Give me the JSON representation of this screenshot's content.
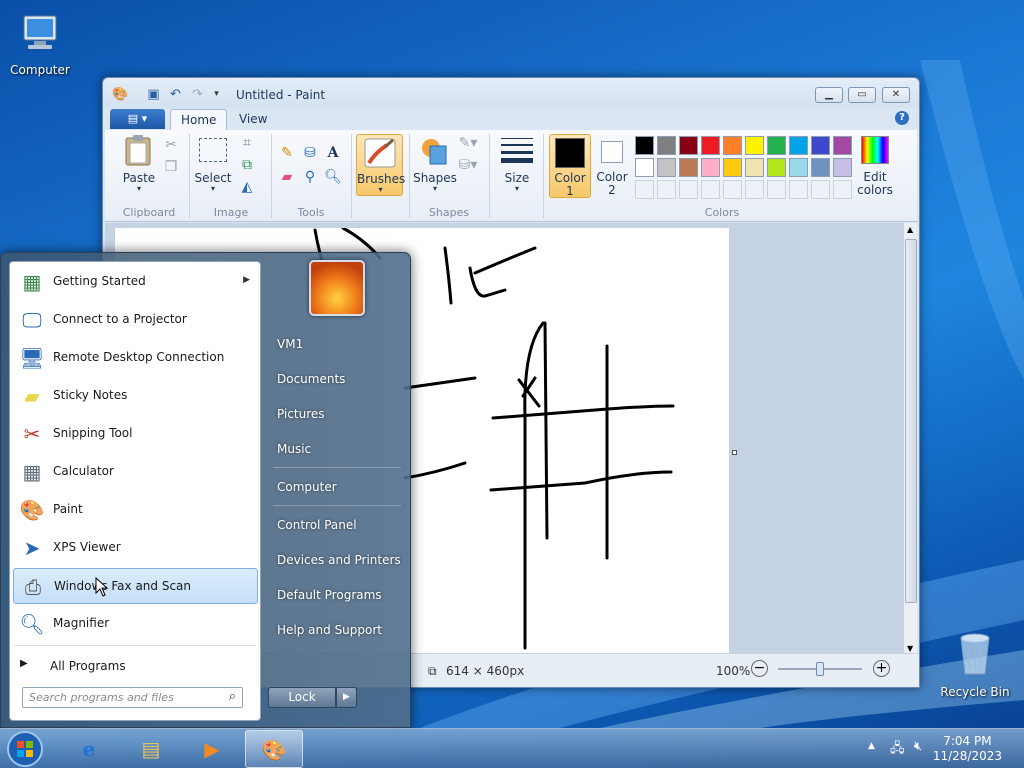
{
  "desktop": {
    "icons": [
      {
        "label": "Computer",
        "icon": "computer-icon"
      },
      {
        "label": "Recycle Bin",
        "icon": "recycle-bin-icon"
      }
    ]
  },
  "paint": {
    "title": "Untitled - Paint",
    "tabs": [
      "Home",
      "View"
    ],
    "groups": {
      "clipboard": {
        "label": "Clipboard",
        "paste": "Paste"
      },
      "image": {
        "label": "Image",
        "select": "Select"
      },
      "tools": {
        "label": "Tools"
      },
      "brushes": {
        "label": "Brushes"
      },
      "shapes": {
        "label": "Shapes",
        "shapes_btn": "Shapes"
      },
      "size": {
        "label": "Size"
      },
      "colors": {
        "label": "Colors",
        "color1": [
          "Color",
          "1"
        ],
        "color2": [
          "Color",
          "2"
        ],
        "edit": [
          "Edit",
          "colors"
        ],
        "palette_row1": [
          "#000000",
          "#7f7f7f",
          "#880015",
          "#ed1c24",
          "#ff7f27",
          "#fff200",
          "#22b14c",
          "#00a2e8",
          "#3f48cc",
          "#a349a4"
        ],
        "palette_row2": [
          "#ffffff",
          "#c3c3c3",
          "#b97a57",
          "#ffaec9",
          "#ffc90e",
          "#efe4b0",
          "#b5e61d",
          "#99d9ea",
          "#7092be",
          "#c8bfe7"
        ]
      }
    },
    "status": {
      "canvas_size": "614 × 460px",
      "zoom": "100%",
      "zoom_fraction": 0.5
    }
  },
  "start_menu": {
    "programs": [
      {
        "label": "Getting Started",
        "icon": "getting-started-icon",
        "submenu": true
      },
      {
        "label": "Connect to a Projector",
        "icon": "projector-icon"
      },
      {
        "label": "Remote Desktop Connection",
        "icon": "remote-desktop-icon"
      },
      {
        "label": "Sticky Notes",
        "icon": "sticky-notes-icon"
      },
      {
        "label": "Snipping Tool",
        "icon": "scissors-icon"
      },
      {
        "label": "Calculator",
        "icon": "calculator-icon"
      },
      {
        "label": "Paint",
        "icon": "paint-palette-icon"
      },
      {
        "label": "XPS Viewer",
        "icon": "xps-viewer-icon"
      },
      {
        "label": "Windows Fax and Scan",
        "icon": "fax-icon"
      },
      {
        "label": "Magnifier",
        "icon": "magnifier-icon"
      }
    ],
    "all_programs": "All Programs",
    "search_placeholder": "Search programs and files",
    "right_items": [
      "VM1",
      "Documents",
      "Pictures",
      "Music",
      "Computer",
      "Control Panel",
      "Devices and Printers",
      "Default Programs",
      "Help and Support"
    ],
    "lock": "Lock"
  },
  "taskbar": {
    "time": "7:04 PM",
    "date": "11/28/2023"
  }
}
